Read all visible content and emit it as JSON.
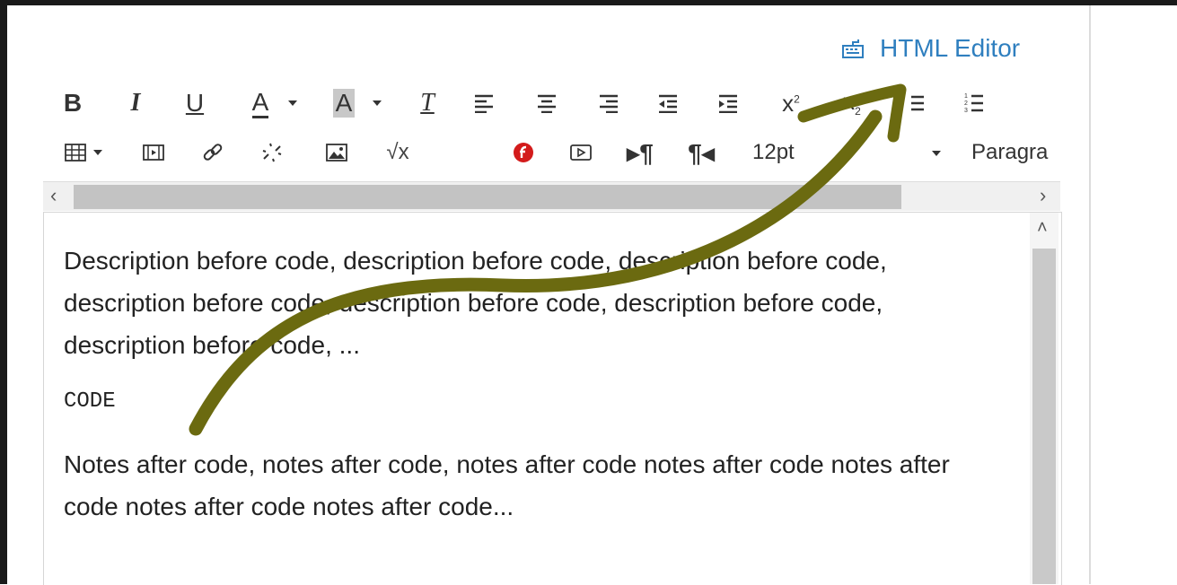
{
  "header": {
    "html_editor_label": "HTML Editor"
  },
  "toolbar": {
    "row1": {
      "bold": "B",
      "italic": "I",
      "underline": "U",
      "font_color": "A",
      "bg_color": "A",
      "clear_format": "T",
      "icons": [
        "bold-icon",
        "italic-icon",
        "underline-icon",
        "text-color-icon",
        "background-color-icon",
        "clear-formatting-icon",
        "align-left-icon",
        "align-center-icon",
        "align-right-icon",
        "outdent-icon",
        "indent-icon",
        "superscript-icon",
        "subscript-icon",
        "bullet-list-icon",
        "numbered-list-icon"
      ]
    },
    "row2": {
      "font_size": "12pt",
      "block_format": "Paragra",
      "icons": [
        "table-icon",
        "media-icon",
        "link-icon",
        "unlink-icon",
        "image-icon",
        "equation-icon",
        "flash-icon",
        "video-icon",
        "ltr-icon",
        "rtl-icon"
      ]
    }
  },
  "editor": {
    "description": "Description before code, description before code, description before code, description before code, description before code, description before code, description before code, ...",
    "code": "CODE",
    "notes": "Notes after code, notes after code, notes after code notes after code notes after code notes after code notes after code..."
  },
  "colors": {
    "accent": "#2f7fbf",
    "arrow": "#6b6a10"
  }
}
